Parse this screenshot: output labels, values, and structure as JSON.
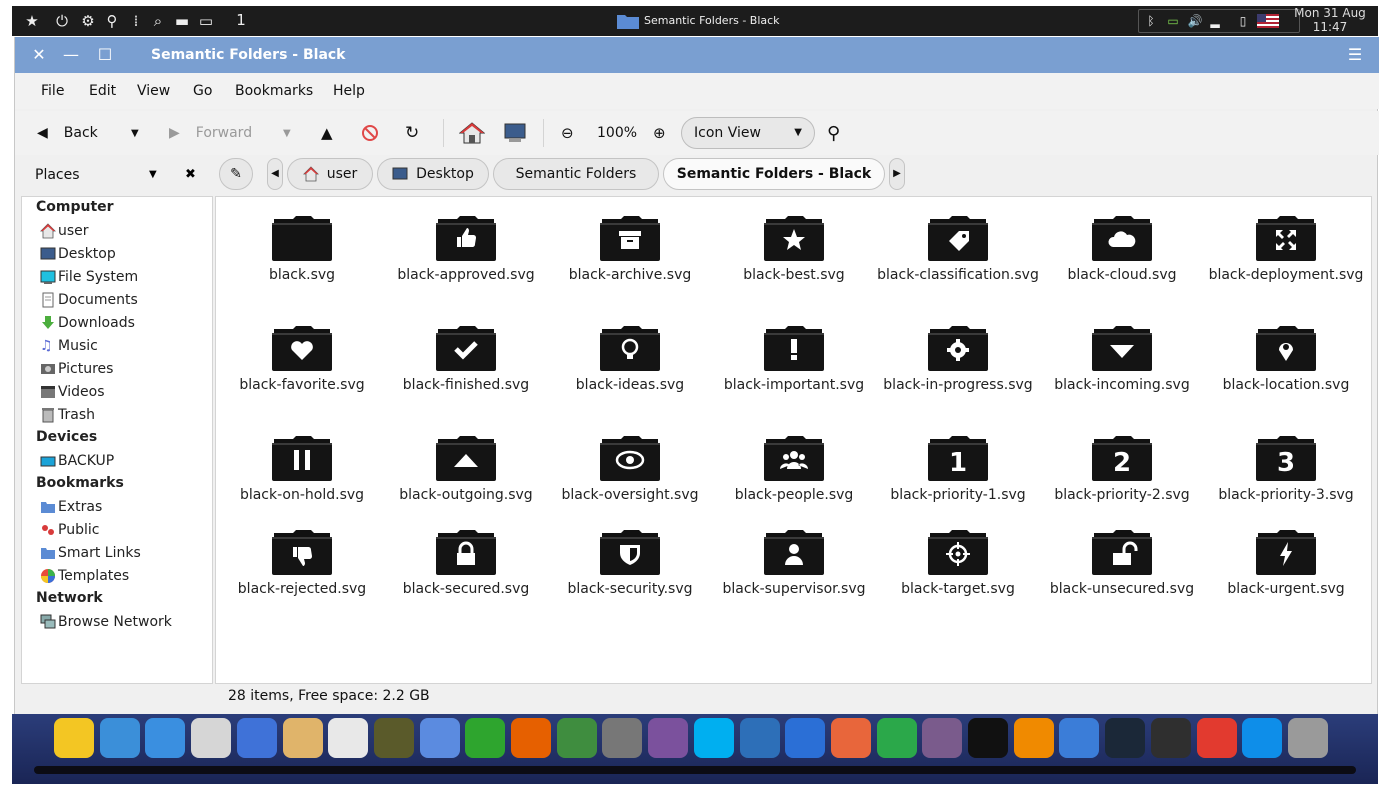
{
  "top_panel": {
    "workspace": "1",
    "task_title": "Semantic Folders - Black",
    "clock_date": "Mon 31 Aug",
    "clock_time": "11:47"
  },
  "window": {
    "title": "Semantic Folders - Black"
  },
  "menu": [
    "File",
    "Edit",
    "View",
    "Go",
    "Bookmarks",
    "Help"
  ],
  "toolbar": {
    "back_label": "Back",
    "forward_label": "Forward",
    "zoom_level": "100%",
    "view_mode": "Icon View"
  },
  "places": {
    "label": "Places",
    "sections": [
      {
        "title": "Computer",
        "items": [
          {
            "label": "user",
            "icon": "home-icon"
          },
          {
            "label": "Desktop",
            "icon": "desktop-icon"
          },
          {
            "label": "File System",
            "icon": "filesystem-icon"
          },
          {
            "label": "Documents",
            "icon": "documents-icon"
          },
          {
            "label": "Downloads",
            "icon": "downloads-icon"
          },
          {
            "label": "Music",
            "icon": "music-icon"
          },
          {
            "label": "Pictures",
            "icon": "pictures-icon"
          },
          {
            "label": "Videos",
            "icon": "videos-icon"
          },
          {
            "label": "Trash",
            "icon": "trash-icon"
          }
        ]
      },
      {
        "title": "Devices",
        "items": [
          {
            "label": "BACKUP",
            "icon": "drive-icon"
          }
        ]
      },
      {
        "title": "Bookmarks",
        "items": [
          {
            "label": "Extras",
            "icon": "folder-icon"
          },
          {
            "label": "Public",
            "icon": "public-icon"
          },
          {
            "label": "Smart Links",
            "icon": "folder-icon"
          },
          {
            "label": "Templates",
            "icon": "templates-icon"
          }
        ]
      },
      {
        "title": "Network",
        "items": [
          {
            "label": "Browse Network",
            "icon": "network-icon"
          }
        ]
      }
    ]
  },
  "breadcrumb": [
    "user",
    "Desktop",
    "Semantic Folders",
    "Semantic Folders - Black"
  ],
  "files": [
    {
      "name": "black.svg",
      "emblem": "none"
    },
    {
      "name": "black-approved.svg",
      "emblem": "thumbs-up"
    },
    {
      "name": "black-archive.svg",
      "emblem": "archive"
    },
    {
      "name": "black-best.svg",
      "emblem": "star"
    },
    {
      "name": "black-classification.svg",
      "emblem": "tag"
    },
    {
      "name": "black-cloud.svg",
      "emblem": "cloud"
    },
    {
      "name": "black-deployment.svg",
      "emblem": "expand"
    },
    {
      "name": "black-favorite.svg",
      "emblem": "heart"
    },
    {
      "name": "black-finished.svg",
      "emblem": "check"
    },
    {
      "name": "black-ideas.svg",
      "emblem": "bulb"
    },
    {
      "name": "black-important.svg",
      "emblem": "exclaim"
    },
    {
      "name": "black-in-progress.svg",
      "emblem": "gear"
    },
    {
      "name": "black-incoming.svg",
      "emblem": "down"
    },
    {
      "name": "black-location.svg",
      "emblem": "pin"
    },
    {
      "name": "black-on-hold.svg",
      "emblem": "pause"
    },
    {
      "name": "black-outgoing.svg",
      "emblem": "up"
    },
    {
      "name": "black-oversight.svg",
      "emblem": "eye"
    },
    {
      "name": "black-people.svg",
      "emblem": "people"
    },
    {
      "name": "black-priority-1.svg",
      "emblem": "1"
    },
    {
      "name": "black-priority-2.svg",
      "emblem": "2"
    },
    {
      "name": "black-priority-3.svg",
      "emblem": "3"
    },
    {
      "name": "black-rejected.svg",
      "emblem": "thumbs-down"
    },
    {
      "name": "black-secured.svg",
      "emblem": "lock"
    },
    {
      "name": "black-security.svg",
      "emblem": "shield"
    },
    {
      "name": "black-supervisor.svg",
      "emblem": "person"
    },
    {
      "name": "black-target.svg",
      "emblem": "target"
    },
    {
      "name": "black-unsecured.svg",
      "emblem": "unlock"
    },
    {
      "name": "black-urgent.svg",
      "emblem": "bolt"
    }
  ],
  "status": "28 items, Free space: 2.2 GB",
  "dock": [
    {
      "name": "star-icon",
      "color": "#f3c623"
    },
    {
      "name": "dots-icon",
      "color": "#3b8fd9"
    },
    {
      "name": "window-icon",
      "color": "#3a8fe0"
    },
    {
      "name": "cabinet-icon",
      "color": "#d6d6d6"
    },
    {
      "name": "toggle-icon",
      "color": "#3f72d8"
    },
    {
      "name": "palette-icon",
      "color": "#e0b46a"
    },
    {
      "name": "store-icon",
      "color": "#e8e8e8"
    },
    {
      "name": "binoculars-icon",
      "color": "#5a5a2a"
    },
    {
      "name": "plane-icon",
      "color": "#5b8be0"
    },
    {
      "name": "pipe-icon",
      "color": "#2ea52e"
    },
    {
      "name": "firefox-icon",
      "color": "#e66000"
    },
    {
      "name": "chrome-icon",
      "color": "#3f8d3f"
    },
    {
      "name": "earth-pro-icon",
      "color": "#777777"
    },
    {
      "name": "viber-icon",
      "color": "#7b519d"
    },
    {
      "name": "skype-icon",
      "color": "#00aff0"
    },
    {
      "name": "mail-icon",
      "color": "#2d6fb8"
    },
    {
      "name": "writer-icon",
      "color": "#2b6fd6"
    },
    {
      "name": "presentation-icon",
      "color": "#e8663b"
    },
    {
      "name": "spreadsheet-icon",
      "color": "#2ba84a"
    },
    {
      "name": "webcam-icon",
      "color": "#7a5b8c"
    },
    {
      "name": "amazon-icon",
      "color": "#111111"
    },
    {
      "name": "vlc-icon",
      "color": "#f08a00"
    },
    {
      "name": "qbittorrent-icon",
      "color": "#3b7dd8"
    },
    {
      "name": "steam-icon",
      "color": "#1b2838"
    },
    {
      "name": "backup-icon",
      "color": "#2f2f2f"
    },
    {
      "name": "anydesk-icon",
      "color": "#e23a2f"
    },
    {
      "name": "teamviewer-icon",
      "color": "#0e8ee9"
    },
    {
      "name": "trashcan-icon",
      "color": "#9a9a9a"
    }
  ]
}
